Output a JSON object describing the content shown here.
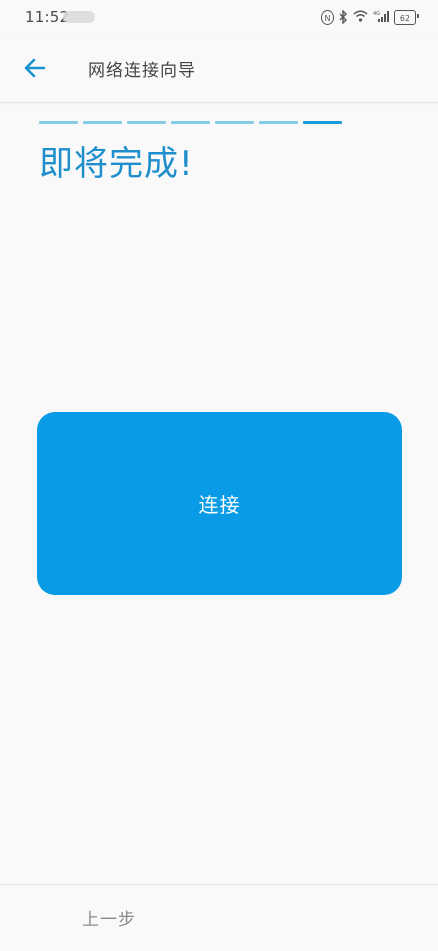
{
  "status_bar": {
    "time": "11:52",
    "icons": [
      "nfc-icon",
      "bluetooth-icon",
      "wifi-icon",
      "4g-signal-icon",
      "battery-icon"
    ],
    "battery_level": "62"
  },
  "toolbar": {
    "title": "网络连接向导",
    "back_icon": "arrow-left-icon"
  },
  "wizard": {
    "total_steps": 7,
    "current_step": 7,
    "heading": "即将完成!",
    "connect_label": "连接"
  },
  "footer": {
    "prev_label": "上一步"
  },
  "colors": {
    "accent": "#1e8fcc",
    "button": "#0a9be6",
    "progress_done": "#86cce9",
    "progress_active": "#1a9ad8",
    "background": "#f9f9f9"
  }
}
